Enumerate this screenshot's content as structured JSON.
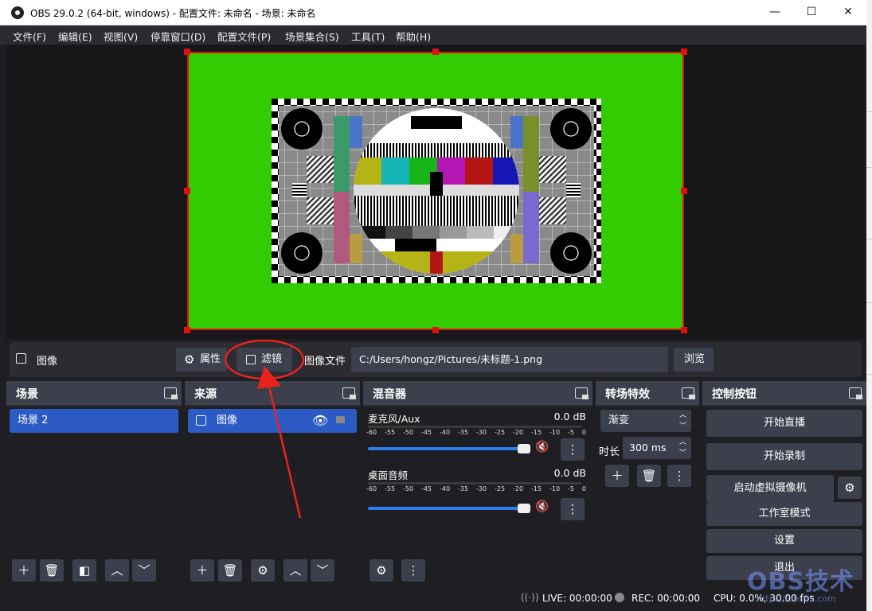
{
  "window": {
    "title": "OBS 29.0.2 (64-bit, windows) - 配置文件: 未命名 - 场景: 未命名",
    "minimize": "—",
    "maximize": "☐",
    "close": "✕"
  },
  "menu": [
    "文件(F)",
    "编辑(E)",
    "视图(V)",
    "停靠窗口(D)",
    "配置文件(P)",
    "场景集合(S)",
    "工具(T)",
    "帮助(H)"
  ],
  "source_toolbar": {
    "source_name": "图像",
    "properties_label": "属性",
    "filters_label": "滤镜",
    "image_file_label": "图像文件",
    "file_path": "C:/Users/hongz/Pictures/未标题-1.png",
    "browse_label": "浏览"
  },
  "scenes": {
    "title": "场景",
    "items": [
      "场景 2"
    ]
  },
  "sources": {
    "title": "来源",
    "items": [
      "图像"
    ]
  },
  "mixer": {
    "title": "混音器",
    "channels": [
      {
        "name": "麦克风/Aux",
        "db": "0.0 dB"
      },
      {
        "name": "桌面音频",
        "db": "0.0 dB"
      }
    ],
    "scale": [
      "-60",
      "-55",
      "-50",
      "-45",
      "-40",
      "-35",
      "-30",
      "-25",
      "-20",
      "-15",
      "-10",
      "-5",
      "0"
    ]
  },
  "transitions": {
    "title": "转场特效",
    "selected": "渐变",
    "duration_label": "时长",
    "duration_value": "300 ms"
  },
  "controls": {
    "title": "控制按钮",
    "start_streaming": "开始直播",
    "start_recording": "开始录制",
    "virtual_camera": "启动虚拟摄像机",
    "studio_mode": "工作室模式",
    "settings": "设置",
    "exit": "退出"
  },
  "status": {
    "live": "LIVE: 00:00:00",
    "rec": "REC: 00:00:00",
    "cpu": "CPU: 0.0%, 30.00 fps"
  },
  "watermark": {
    "brand": "OBS技术",
    "url": "https://obs99.com"
  },
  "colors": {
    "accent": "#2d5bc6",
    "canvas_green": "#33cc00",
    "selection_red": "#e01010",
    "annotation_red": "#e8231e"
  }
}
